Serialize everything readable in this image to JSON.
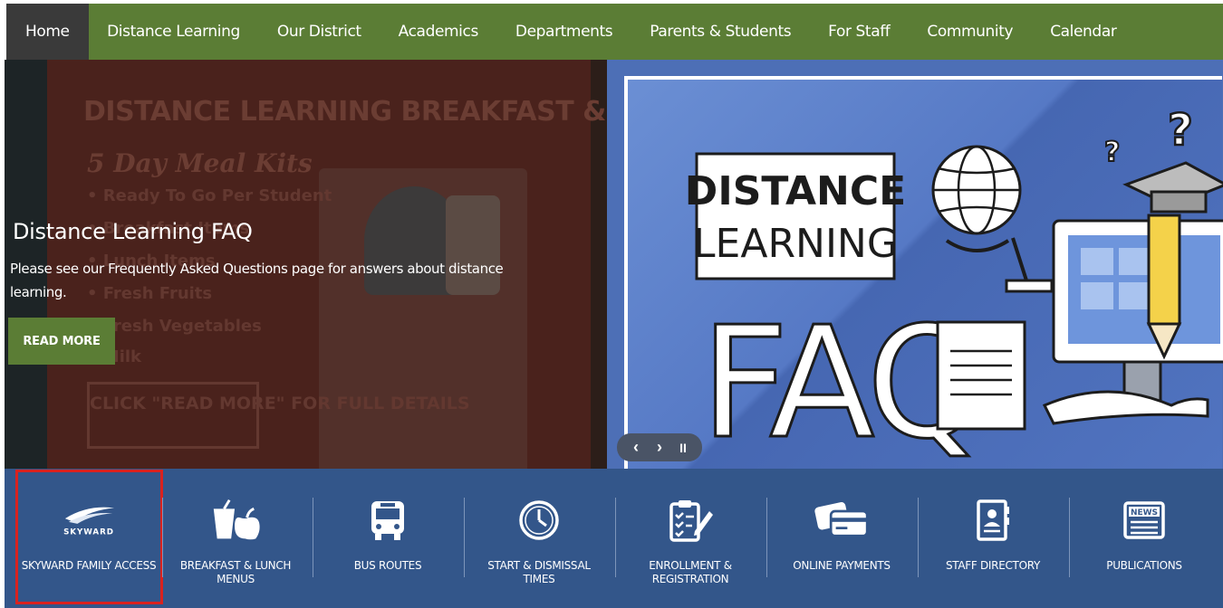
{
  "nav": {
    "items": [
      {
        "label": "Home",
        "active": true
      },
      {
        "label": "Distance Learning"
      },
      {
        "label": "Our District"
      },
      {
        "label": "Academics"
      },
      {
        "label": "Departments"
      },
      {
        "label": "Parents & Students"
      },
      {
        "label": "For Staff"
      },
      {
        "label": "Community"
      },
      {
        "label": "Calendar"
      }
    ]
  },
  "hero": {
    "background_poster": {
      "title": "DISTANCE LEARNING BREAKFAST & LUNCH",
      "subtitle": "5 Day Meal Kits",
      "bullets": [
        "Ready To Go Per Student",
        "Breakfast Items",
        "Lunch Items",
        "Fresh Fruits",
        "Fresh Vegetables",
        "Milk"
      ],
      "box_text": "CLICK \"READ MORE\" FOR FULL DETAILS"
    },
    "heading": "Distance Learning FAQ",
    "description": "Please see our Frequently Asked Questions page for answers about distance learning.",
    "read_more": "READ MORE",
    "graphic": {
      "line1": "DISTANCE",
      "line2": "LEARNING",
      "line3": "FAQ"
    },
    "controls": {
      "prev": "‹",
      "next": "›",
      "pause": "II"
    }
  },
  "quick_links": [
    {
      "label": "SKYWARD FAMILY ACCESS",
      "icon": "skyward-logo-icon",
      "logo_text": "SKYWARD",
      "highlighted": true
    },
    {
      "label": "BREAKFAST & LUNCH MENUS",
      "icon": "drink-apple-icon"
    },
    {
      "label": "BUS ROUTES",
      "icon": "bus-icon"
    },
    {
      "label": "START & DISMISSAL TIMES",
      "icon": "clock-icon"
    },
    {
      "label": "ENROLLMENT & REGISTRATION",
      "icon": "clipboard-icon"
    },
    {
      "label": "ONLINE PAYMENTS",
      "icon": "credit-card-icon"
    },
    {
      "label": "STAFF DIRECTORY",
      "icon": "contact-card-icon"
    },
    {
      "label": "PUBLICATIONS",
      "icon": "newspaper-icon",
      "icon_text": "NEWS"
    }
  ],
  "colors": {
    "nav_bg": "#5b7d35",
    "nav_active": "#3a3a3a",
    "quick_links_bg": "#33568a",
    "highlight": "#d9221f",
    "hero_blue": "#4d6fb6"
  }
}
